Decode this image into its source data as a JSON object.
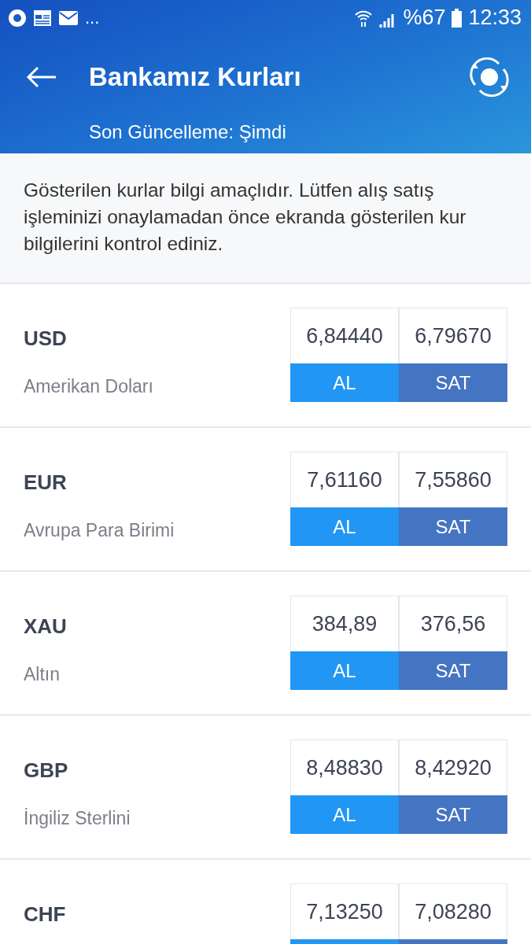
{
  "status_bar": {
    "more": "...",
    "battery": "%67",
    "time": "12:33"
  },
  "header": {
    "title": "Bankamız Kurları",
    "subtitle": "Son Güncelleme: Şimdi"
  },
  "notice": "Gösterilen kurlar bilgi amaçlıdır. Lütfen alış satış işleminizi onaylamadan önce ekranda gösterilen kur bilgilerini kontrol ediniz.",
  "rates": [
    {
      "code": "USD",
      "name": "Amerikan Doları",
      "buy": "6,84440",
      "sell": "6,79670",
      "buy_label": "AL",
      "sell_label": "SAT"
    },
    {
      "code": "EUR",
      "name": "Avrupa Para Birimi",
      "buy": "7,61160",
      "sell": "7,55860",
      "buy_label": "AL",
      "sell_label": "SAT"
    },
    {
      "code": "XAU",
      "name": "Altın",
      "buy": "384,89",
      "sell": "376,56",
      "buy_label": "AL",
      "sell_label": "SAT"
    },
    {
      "code": "GBP",
      "name": "İngiliz Sterlini",
      "buy": "8,48830",
      "sell": "8,42920",
      "buy_label": "AL",
      "sell_label": "SAT"
    },
    {
      "code": "CHF",
      "buy": "7,13250",
      "sell": "7,08280"
    }
  ]
}
